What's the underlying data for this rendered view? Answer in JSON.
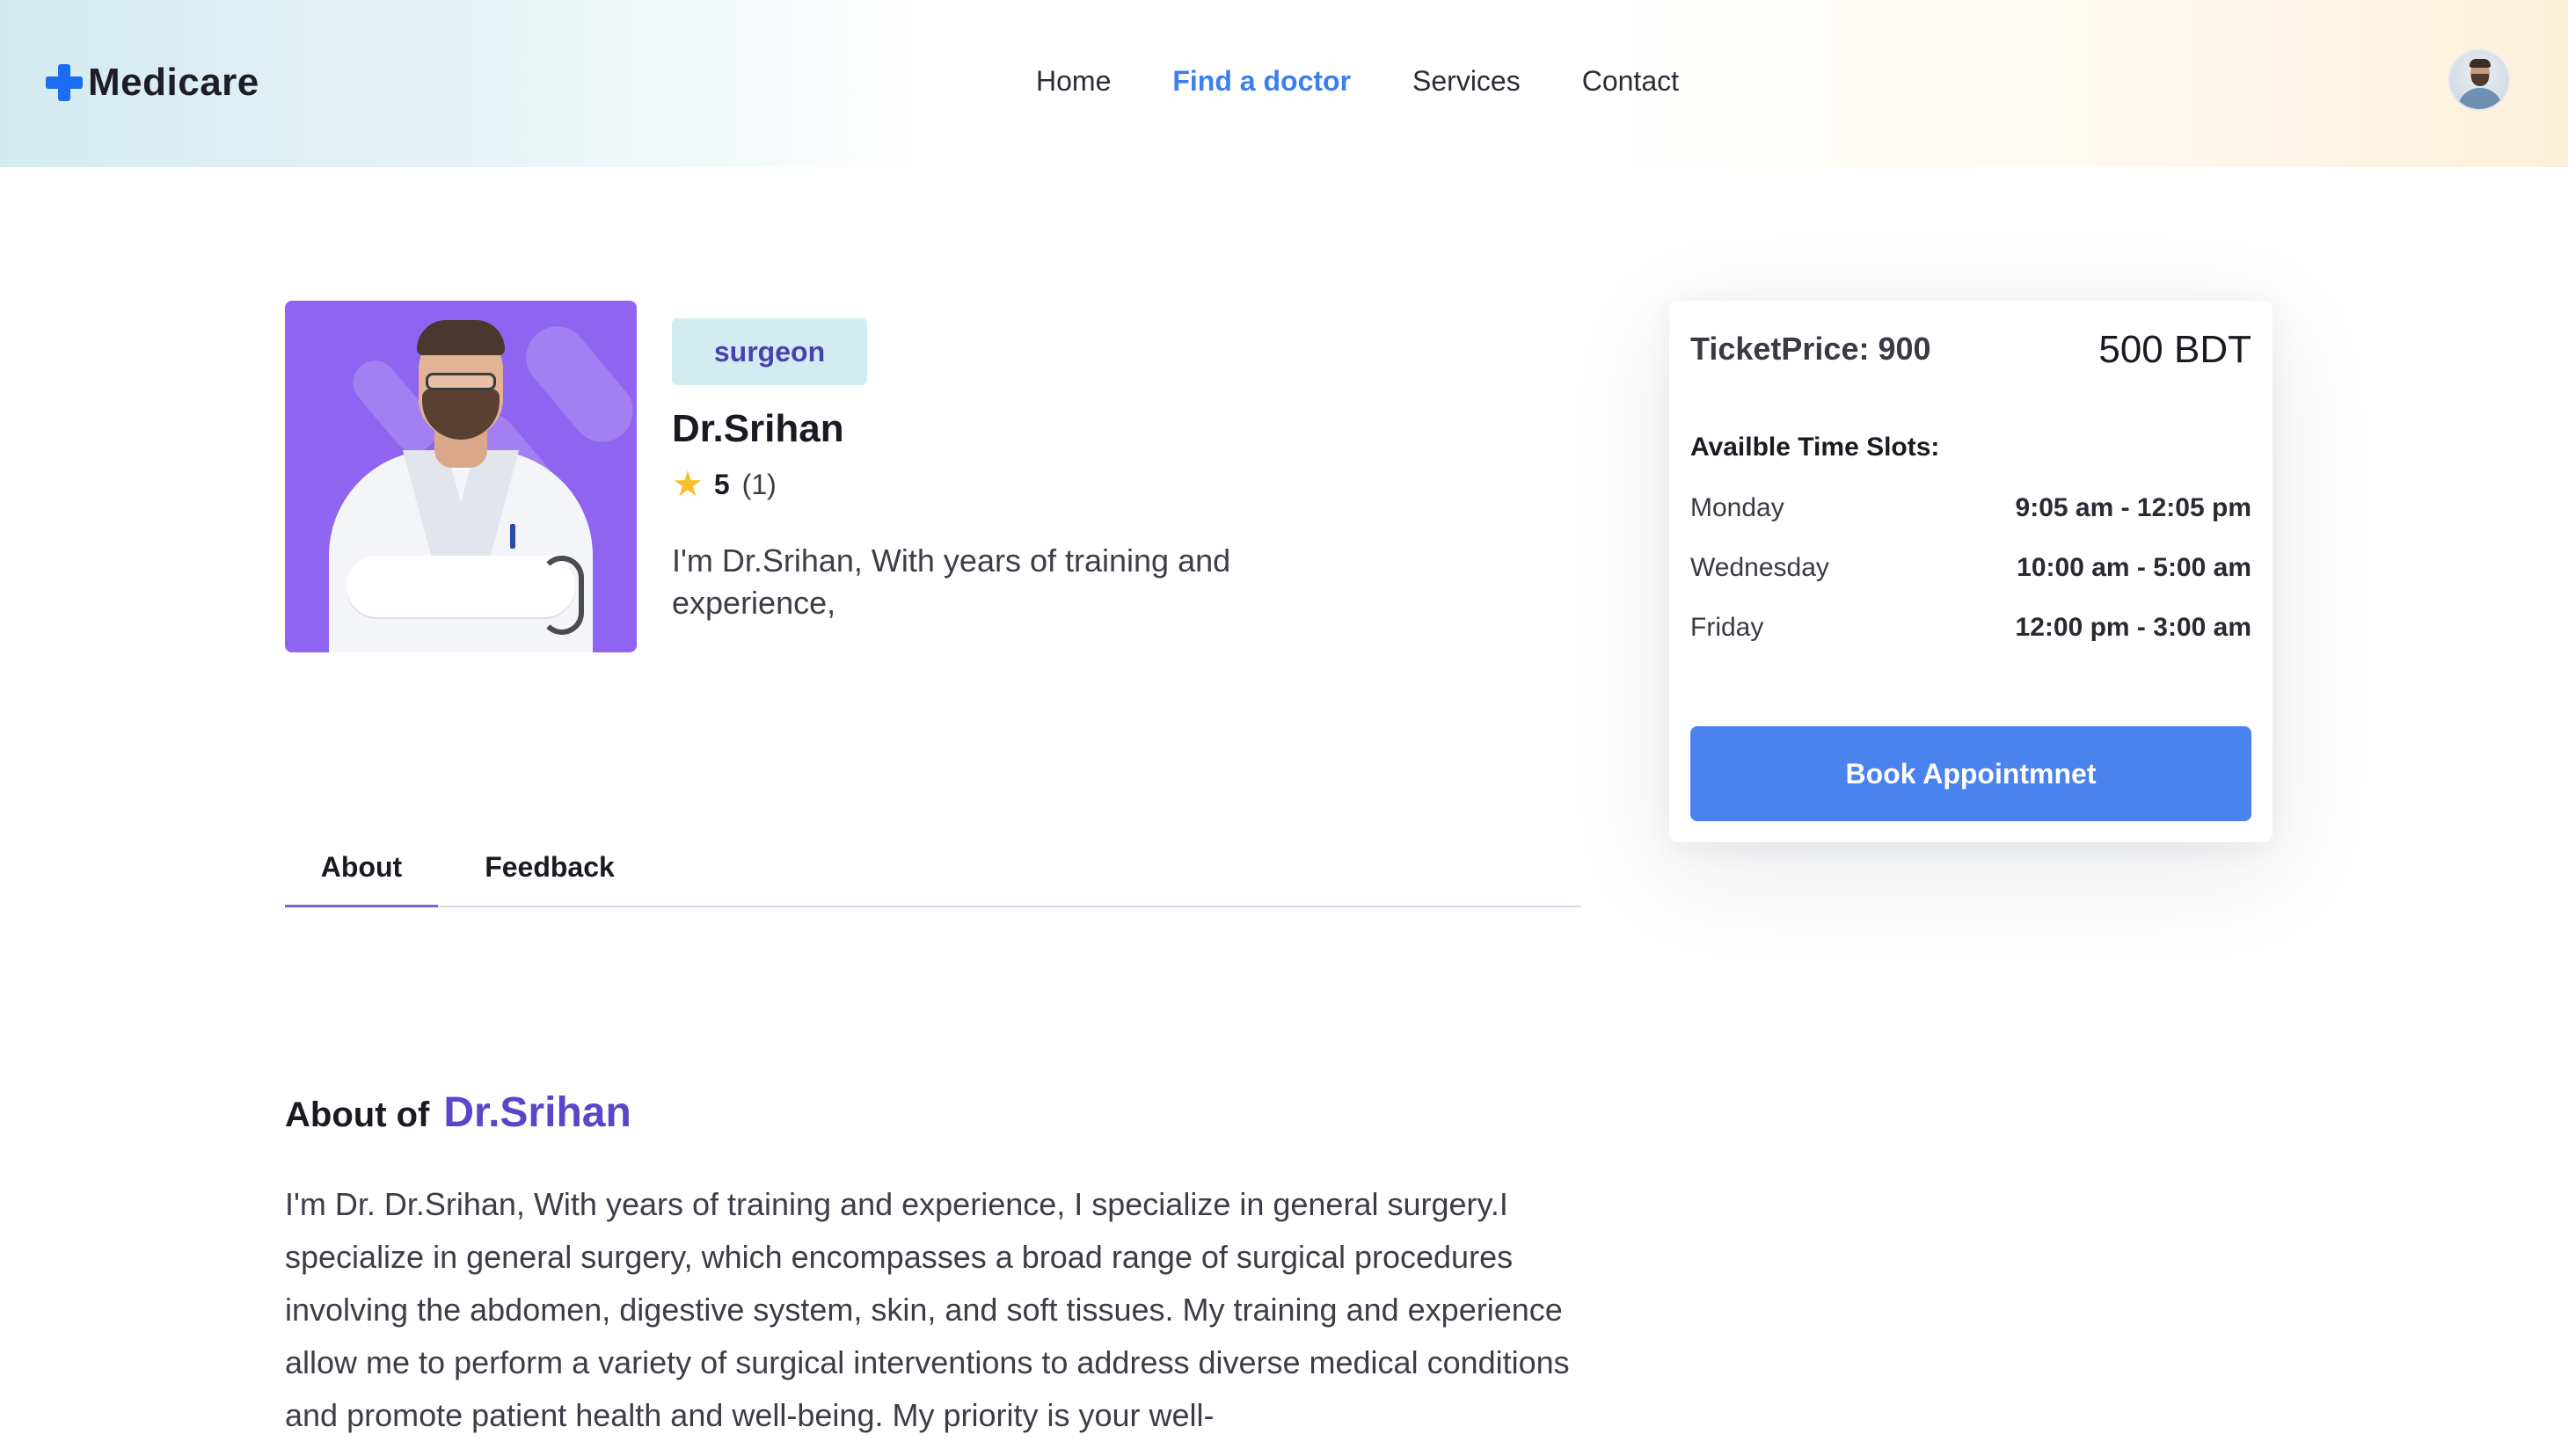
{
  "brand": {
    "name": "Medicare",
    "icon": "plus-icon",
    "color": "#1a6cf0"
  },
  "nav": {
    "items": [
      {
        "label": "Home",
        "active": false
      },
      {
        "label": "Find a doctor",
        "active": true
      },
      {
        "label": "Services",
        "active": false
      },
      {
        "label": "Contact",
        "active": false
      }
    ],
    "active_color": "#3b7ff0"
  },
  "user": {
    "avatar_icon": "user-avatar"
  },
  "doctor": {
    "specialty": "surgeon",
    "name": "Dr.Srihan",
    "rating": "5",
    "reviews": "(1)",
    "rating_icon": "star-icon",
    "short_bio": "I'm Dr.Srihan, With years of training and experience,",
    "photo_bg_color": "#8e64f0"
  },
  "booking": {
    "ticket_label": "TicketPrice: 900",
    "ticket_amount": "500 BDT",
    "slots_title": "Availble Time Slots:",
    "slots": [
      {
        "day": "Monday",
        "time": "9:05 am - 12:05 pm"
      },
      {
        "day": "Wednesday",
        "time": "10:00 am - 5:00 am"
      },
      {
        "day": "Friday",
        "time": "12:00 pm - 3:00 am"
      }
    ],
    "button_label": "Book Appointmnet",
    "button_color": "#4a82ee"
  },
  "tabs": {
    "items": [
      {
        "label": "About",
        "active": true
      },
      {
        "label": "Feedback",
        "active": false
      }
    ],
    "indicator_color": "#7a5ce8"
  },
  "about": {
    "prefix": "About of",
    "name": "Dr.Srihan",
    "name_color": "#5a46c8",
    "text": "I'm Dr. Dr.Srihan, With years of training and experience, I specialize in general surgery.I specialize in general surgery, which encompasses a broad range of surgical procedures involving the abdomen, digestive system, skin, and soft tissues. My training and experience allow me to perform a variety of surgical interventions to address diverse medical conditions and promote patient health and well-being. My priority is your well-"
  }
}
